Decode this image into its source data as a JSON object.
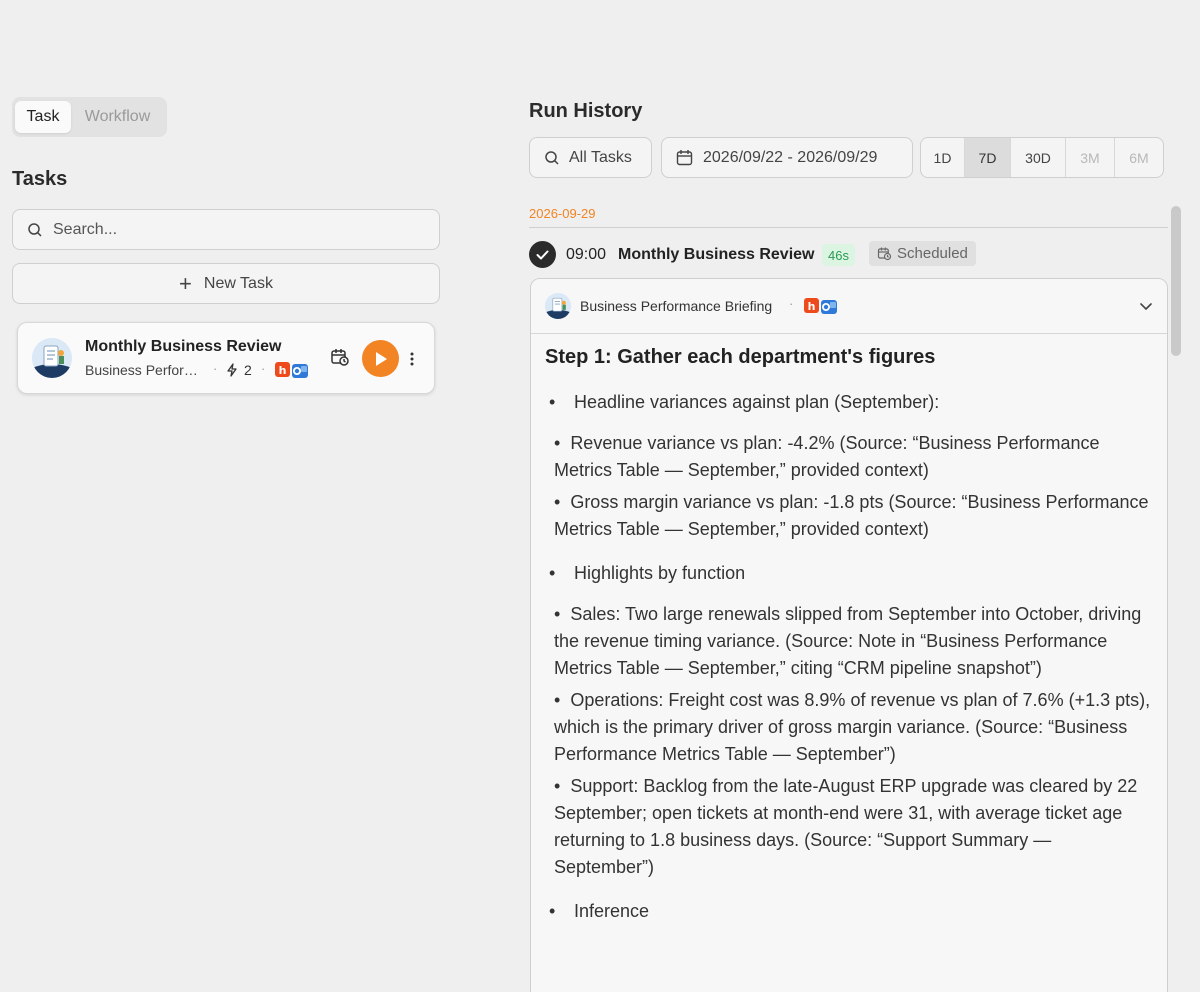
{
  "left": {
    "segment": {
      "task_label": "Task",
      "workflow_label": "Workflow"
    },
    "heading": "Tasks",
    "search": {
      "placeholder": "Search..."
    },
    "new_task_label": "New Task",
    "task_card": {
      "title": "Monthly Business Review",
      "subtitle": "Business Performance Briefing",
      "run_count": "2"
    }
  },
  "right": {
    "title": "Run History",
    "filters": {
      "all_tasks": "All Tasks",
      "date_range": "2026/09/22 - 2026/09/29",
      "ranges": [
        "1D",
        "7D",
        "30D",
        "3M",
        "6M"
      ],
      "active_range": "7D"
    },
    "group_date": "2026-09-29",
    "run": {
      "time": "09:00",
      "name": "Monthly Business Review",
      "duration": "46s",
      "status": "Scheduled"
    },
    "result": {
      "header": "Business Performance Briefing",
      "step_title": "Step 1: Gather each department's figures",
      "sections": [
        {
          "heading": "Headline variances against plan (September):",
          "items": [
            "Revenue variance vs plan: -4.2% (Source: “Business Performance Metrics Table — September,” provided context)",
            "Gross margin variance vs plan: -1.8 pts (Source: “Business Performance Metrics Table — September,” provided context)"
          ]
        },
        {
          "heading": "Highlights by function",
          "items": [
            "Sales: Two large renewals slipped from September into October, driving the revenue timing variance. (Source: Note in “Business Performance Metrics Table — September,” citing “CRM pipeline snapshot”)",
            "Operations: Freight cost was 8.9% of revenue vs plan of 7.6% (+1.3 pts), which is the primary driver of gross margin variance. (Source: “Business Performance Metrics Table — September”)",
            "Support: Backlog from the late-August ERP upgrade was cleared by 22 September; open tickets at month-end were 31, with average ticket age returning to 1.8 business days. (Source: “Support Summary — September”)"
          ]
        },
        {
          "heading": "Inference",
          "items": []
        }
      ]
    }
  },
  "colors": {
    "accent": "#f28424",
    "background": "#efefef",
    "success_bg": "#dcf5e3",
    "success_text": "#2b9a52"
  },
  "icons": {
    "search": "search-icon",
    "plus": "plus-icon",
    "calendar": "calendar-icon",
    "schedule": "calendar-clock-icon",
    "play": "play-icon",
    "more": "more-vertical-icon",
    "bolt": "bolt-icon",
    "check": "check-icon",
    "chevron": "chevron-down-icon",
    "apps": [
      "hubspot-app-icon",
      "outlook-app-icon"
    ]
  }
}
